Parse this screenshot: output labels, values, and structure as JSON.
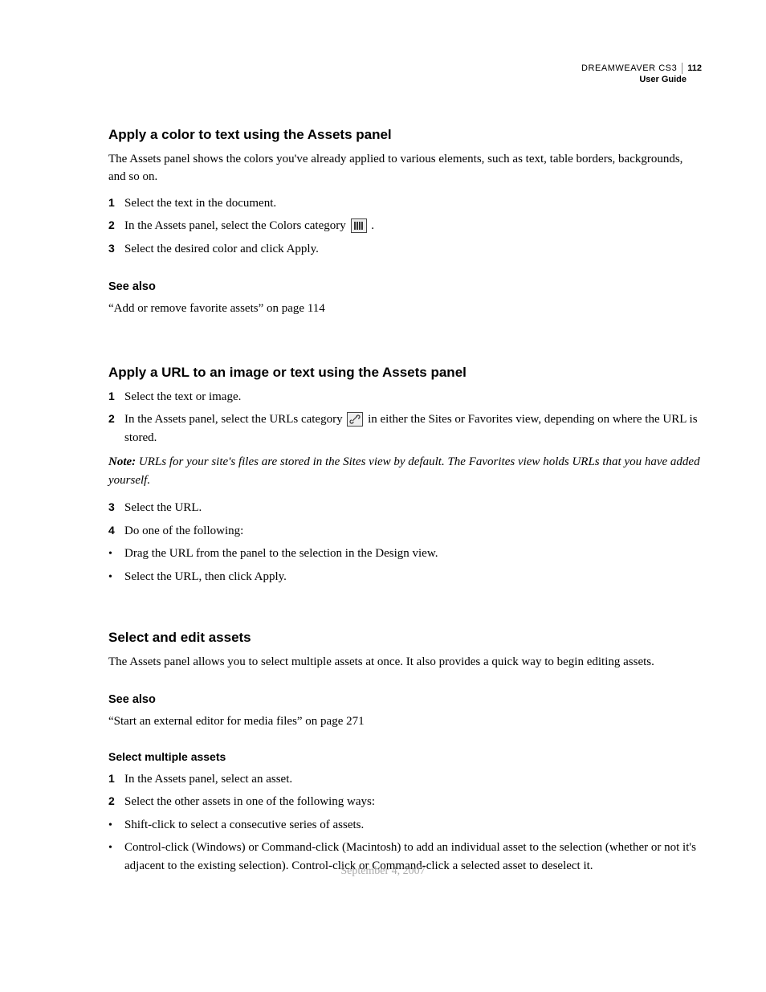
{
  "header": {
    "product": "DREAMWEAVER CS3",
    "page_number": "112",
    "doc_title": "User Guide"
  },
  "sections": {
    "colorToText": {
      "title": "Apply a color to text using the Assets panel",
      "intro": "The Assets panel shows the colors you've already applied to various elements, such as text, table borders, backgrounds, and so on.",
      "step1": "Select the text in the document.",
      "step2_pre": "In the Assets panel, select the Colors category ",
      "step2_post": ".",
      "step3": "Select the desired color and click Apply.",
      "seeAlsoTitle": "See also",
      "seeAlsoRef": "“Add or remove favorite assets” on page 114"
    },
    "urlToAsset": {
      "title": "Apply a URL to an image or text using the Assets panel",
      "step1": "Select the text or image.",
      "step2_pre": "In the Assets panel, select the URLs category ",
      "step2_post": " in either the Sites or Favorites view, depending on where the URL is stored.",
      "noteLabel": "Note:",
      "noteBody": " URLs for your site's files are stored in the Sites view by default. The Favorites view holds URLs that you have added yourself.",
      "step3": "Select the URL.",
      "step4": "Do one of the following:",
      "bullet1": "Drag the URL from the panel to the selection in the Design view.",
      "bullet2": "Select the URL, then click Apply."
    },
    "selectEdit": {
      "title": "Select and edit assets",
      "intro": "The Assets panel allows you to select multiple assets at once. It also provides a quick way to begin editing assets.",
      "seeAlsoTitle": "See also",
      "seeAlsoRef": "“Start an external editor for media files” on page 271",
      "subhead": "Select multiple assets",
      "step1": "In the Assets panel, select an asset.",
      "step2": "Select the other assets in one of the following ways:",
      "bullet1": "Shift-click to select a consecutive series of assets.",
      "bullet2": "Control-click (Windows) or Command-click (Macintosh) to add an individual asset to the selection (whether or not it's adjacent to the existing selection). Control-click or Command-click a selected asset to deselect it."
    }
  },
  "marks": {
    "n1": "1",
    "n2": "2",
    "n3": "3",
    "n4": "4",
    "bullet": "•"
  },
  "footer": {
    "date": "September 4, 2007"
  }
}
